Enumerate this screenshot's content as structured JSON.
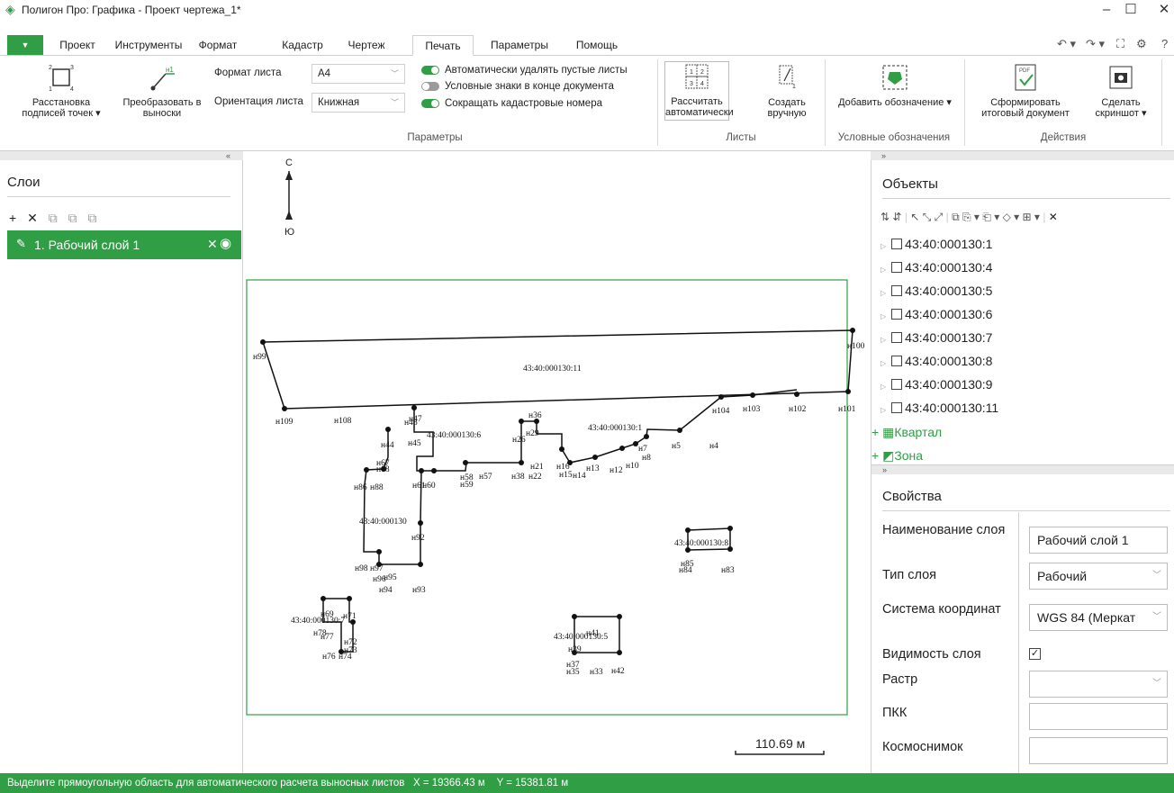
{
  "app": {
    "title": "Полигон Про: Графика - Проект чертежа_1*",
    "logo_icon": "polygon-logo-icon",
    "accent_color": "#2f9e44"
  },
  "menu": {
    "tabs": [
      "Проект",
      "Инструменты",
      "Формат",
      "Кадастр",
      "Чертеж",
      "Печать",
      "Параметры",
      "Помощь"
    ],
    "active_tab": "Печать"
  },
  "ribbon": {
    "points_btn": "Расстановка подписей точек ▾",
    "callouts_btn": "Преобразовать в выноски",
    "sheet_format_label": "Формат листа",
    "sheet_format_value": "A4",
    "orientation_label": "Ориентация листа",
    "orientation_value": "Книжная",
    "params_group": "Параметры",
    "toggle_delete_empty": "Автоматически удалять пустые листы",
    "toggle_legend_end": "Условные знаки в конце документа",
    "toggle_shorten_numbers": "Сокращать кадастровые номера",
    "calc_auto_btn": "Рассчитать автоматически",
    "create_manual_btn": "Создать вручную",
    "sheets_group": "Листы",
    "add_legend_btn": "Добавить обозначение ▾",
    "legend_group": "Условные обозначения",
    "final_doc_btn": "Сформировать итоговый документ",
    "screenshot_btn": "Сделать скриншот ▾",
    "actions_group": "Действия"
  },
  "layers_panel": {
    "collapse": "«",
    "title": "Слои",
    "layer_name": "1. Рабочий слой 1"
  },
  "map": {
    "north": "С",
    "south": "Ю",
    "scale_text": "110.69 м",
    "labels": [
      {
        "t": "н99"
      },
      {
        "t": "н100"
      },
      {
        "t": "43:40:000130:11"
      },
      {
        "t": "н109"
      },
      {
        "t": "н108"
      },
      {
        "t": "н47"
      },
      {
        "t": "н46"
      },
      {
        "t": "43:40:000130:6"
      },
      {
        "t": "н44"
      },
      {
        "t": "н45"
      },
      {
        "t": "н36"
      },
      {
        "t": "н29"
      },
      {
        "t": "н26"
      },
      {
        "t": "43:40:000130:1"
      },
      {
        "t": "н104"
      },
      {
        "t": "н103"
      },
      {
        "t": "н102"
      },
      {
        "t": "н101"
      },
      {
        "t": "н5"
      },
      {
        "t": "н4"
      },
      {
        "t": "н8"
      },
      {
        "t": "н7"
      },
      {
        "t": "н10"
      },
      {
        "t": "н12"
      },
      {
        "t": "н13"
      },
      {
        "t": "н14"
      },
      {
        "t": "н15"
      },
      {
        "t": "н16"
      },
      {
        "t": "н21"
      },
      {
        "t": "н22"
      },
      {
        "t": "н38"
      },
      {
        "t": "н58"
      },
      {
        "t": "н57"
      },
      {
        "t": "н59"
      },
      {
        "t": "н67"
      },
      {
        "t": "н68"
      },
      {
        "t": "н86"
      },
      {
        "t": "н88"
      },
      {
        "t": "н61"
      },
      {
        "t": "н60"
      },
      {
        "t": "43:40:000130"
      },
      {
        "t": "н92"
      },
      {
        "t": "н98"
      },
      {
        "t": "н97"
      },
      {
        "t": "н96"
      },
      {
        "t": "н95"
      },
      {
        "t": "н94"
      },
      {
        "t": "н93"
      },
      {
        "t": "43:40:000130:8"
      },
      {
        "t": "н85"
      },
      {
        "t": "н84"
      },
      {
        "t": "н83"
      },
      {
        "t": "н69"
      },
      {
        "t": "н71"
      },
      {
        "t": "43:40:000130:7"
      },
      {
        "t": "н78"
      },
      {
        "t": "н77"
      },
      {
        "t": "н72"
      },
      {
        "t": "н73"
      },
      {
        "t": "н76"
      },
      {
        "t": "н74"
      },
      {
        "t": "43:40:000130:5"
      },
      {
        "t": "н39"
      },
      {
        "t": "н41"
      },
      {
        "t": "н37"
      },
      {
        "t": "н35"
      },
      {
        "t": "н33"
      },
      {
        "t": "н42"
      }
    ]
  },
  "objects_panel": {
    "expand": "»",
    "title": "Объекты",
    "items": [
      "43:40:000130:1",
      "43:40:000130:4",
      "43:40:000130:5",
      "43:40:000130:6",
      "43:40:000130:7",
      "43:40:000130:8",
      "43:40:000130:9",
      "43:40:000130:11"
    ],
    "group_quarter": "Квартал",
    "group_zone": "Зона"
  },
  "properties_panel": {
    "expand": "»",
    "title": "Свойства",
    "name_label": "Наименование слоя",
    "name_value": "Рабочий слой 1",
    "type_label": "Тип слоя",
    "type_value": "Рабочий",
    "crs_label": "Система координат",
    "crs_value": "WGS 84 (Меркат",
    "visibility_label": "Видимость слоя",
    "raster_label": "Растр",
    "pkk_label": "ПКК",
    "satellite_label": "Космоснимок"
  },
  "status": {
    "message": "Выделите прямоугольную область для автоматического расчета выносных листов",
    "x": "X = 19366.43 м",
    "y": "Y = 15381.81 м"
  }
}
